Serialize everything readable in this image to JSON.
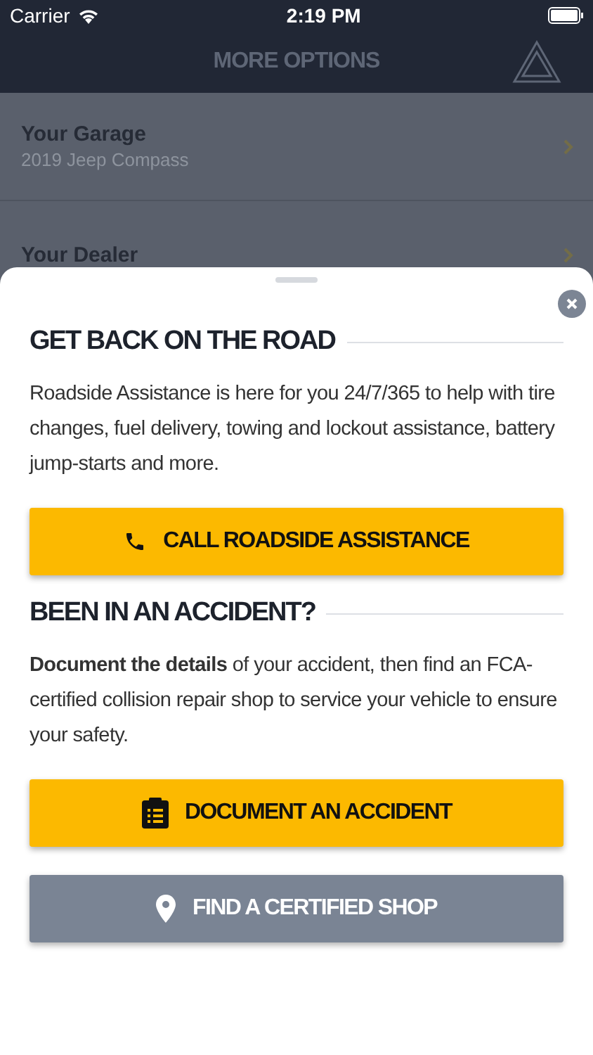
{
  "status_bar": {
    "carrier": "Carrier",
    "time": "2:19 PM"
  },
  "header": {
    "title": "MORE OPTIONS"
  },
  "menu": [
    {
      "title": "Your Garage",
      "subtitle": "2019 Jeep Compass"
    },
    {
      "title": "Your Dealer"
    }
  ],
  "sheet": {
    "sections": [
      {
        "heading": "GET BACK ON THE ROAD",
        "text": "Roadside Assistance is here for you 24/7/365 to help with tire changes, fuel delivery, towing and lockout assistance, battery jump-starts and more.",
        "buttons": [
          {
            "label": "CALL ROADSIDE ASSISTANCE",
            "kind": "call"
          }
        ]
      },
      {
        "heading": "BEEN IN AN ACCIDENT?",
        "text": "**Document the details** of your accident, then find an FCA-certified collision repair shop to service your vehicle to ensure your safety.",
        "buttons": [
          {
            "label": "DOCUMENT AN ACCIDENT",
            "kind": "document"
          },
          {
            "label": "FIND A CERTIFIED SHOP",
            "kind": "find"
          }
        ]
      }
    ]
  }
}
